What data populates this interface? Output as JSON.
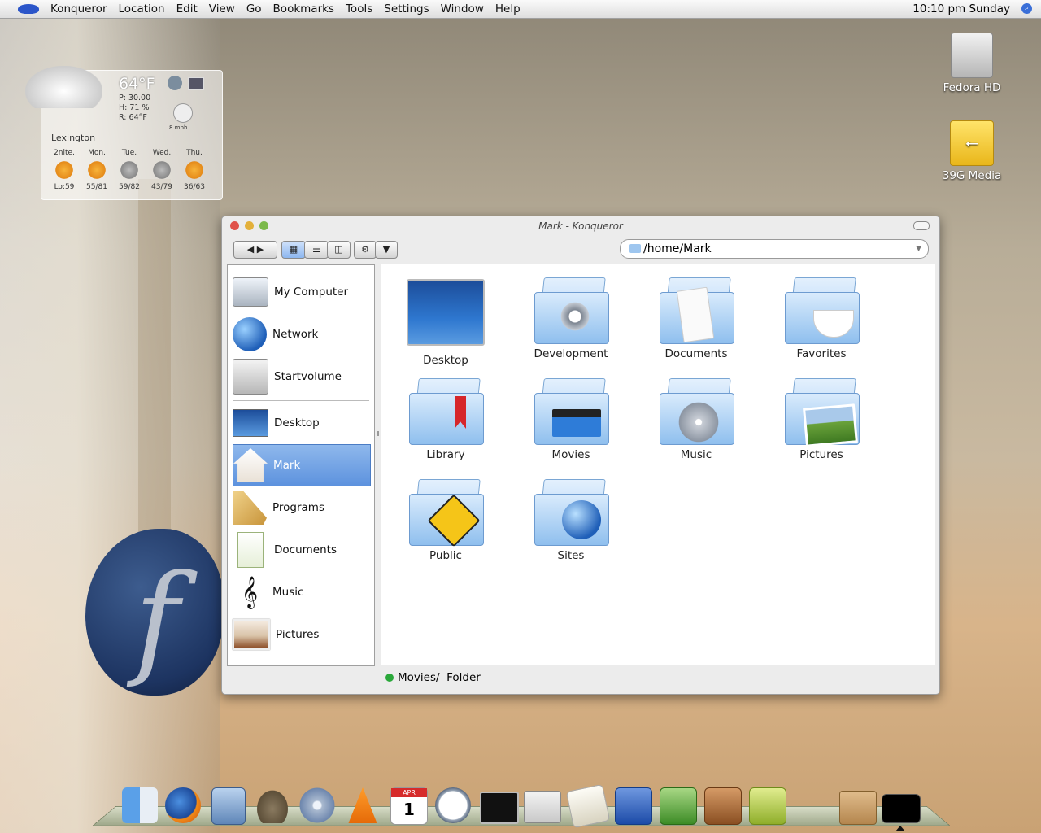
{
  "menubar": {
    "app_name": "Konqueror",
    "items": [
      "Location",
      "Edit",
      "View",
      "Go",
      "Bookmarks",
      "Tools",
      "Settings",
      "Window",
      "Help"
    ],
    "clock": "10:10 pm Sunday"
  },
  "weather": {
    "temp": "64°F",
    "pressure": "P: 30.00",
    "humidity": "H: 71 %",
    "feels": "R: 64°F",
    "wind": "8 mph",
    "city": "Lexington",
    "days": [
      {
        "name": "2nite.",
        "range": "Lo:59",
        "icon": "partly-sunny"
      },
      {
        "name": "Mon.",
        "range": "55/81",
        "icon": "partly-sunny"
      },
      {
        "name": "Tue.",
        "range": "59/82",
        "icon": "thunderstorm"
      },
      {
        "name": "Wed.",
        "range": "43/79",
        "icon": "thunderstorm"
      },
      {
        "name": "Thu.",
        "range": "36/63",
        "icon": "sunny"
      }
    ]
  },
  "desktop": {
    "icons": [
      {
        "label": "Fedora HD",
        "icon": "hard-drive-icon"
      },
      {
        "label": "39G Media",
        "icon": "usb-drive-icon"
      }
    ]
  },
  "window": {
    "title": "Mark - Konqueror",
    "location": "/home/Mark",
    "sidebar": {
      "devices": [
        {
          "label": "My Computer",
          "icon": "computer-icon"
        },
        {
          "label": "Network",
          "icon": "network-globe-icon"
        },
        {
          "label": "Startvolume",
          "icon": "hard-drive-icon"
        }
      ],
      "places": [
        {
          "label": "Desktop",
          "icon": "desktop-icon"
        },
        {
          "label": "Mark",
          "icon": "home-icon",
          "selected": true
        },
        {
          "label": "Programs",
          "icon": "programs-icon"
        },
        {
          "label": "Documents",
          "icon": "document-icon"
        },
        {
          "label": "Music",
          "icon": "music-clef-icon"
        },
        {
          "label": "Pictures",
          "icon": "pictures-icon"
        }
      ]
    },
    "files": [
      {
        "label": "Desktop",
        "icon": "desktop-folder-icon"
      },
      {
        "label": "Development",
        "icon": "gear-folder-icon"
      },
      {
        "label": "Documents",
        "icon": "documents-folder-icon"
      },
      {
        "label": "Favorites",
        "icon": "coffee-folder-icon"
      },
      {
        "label": "Library",
        "icon": "bookmark-folder-icon"
      },
      {
        "label": "Movies",
        "icon": "clapper-folder-icon"
      },
      {
        "label": "Music",
        "icon": "music-folder-icon"
      },
      {
        "label": "Pictures",
        "icon": "picture-folder-icon"
      },
      {
        "label": "Public",
        "icon": "public-folder-icon"
      },
      {
        "label": "Sites",
        "icon": "globe-folder-icon"
      }
    ],
    "status": "Movies/  Folder"
  },
  "dock": {
    "icons": [
      "finder-icon",
      "firefox-icon",
      "mail-icon",
      "gimp-icon",
      "itunes-icon",
      "vlc-icon",
      "calendar-icon",
      "clock-icon",
      "terminal-icon",
      "system-settings-icon",
      "text-editor-icon",
      "writer-icon",
      "calc-icon",
      "impress-icon",
      "draw-icon",
      "trash-icon",
      "desktop-switch-icon"
    ],
    "calendar_month": "APR",
    "calendar_day": "1"
  }
}
